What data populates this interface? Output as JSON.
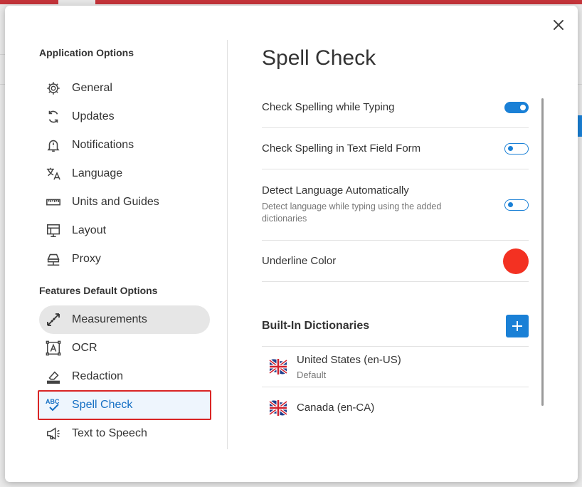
{
  "dialog": {
    "sidebar": {
      "application_section": "Application Options",
      "application_items": [
        {
          "label": "General",
          "icon": "gear-icon"
        },
        {
          "label": "Updates",
          "icon": "sync-icon"
        },
        {
          "label": "Notifications",
          "icon": "bell-icon"
        },
        {
          "label": "Language",
          "icon": "translate-icon"
        },
        {
          "label": "Units and Guides",
          "icon": "ruler-icon"
        },
        {
          "label": "Layout",
          "icon": "layout-icon"
        },
        {
          "label": "Proxy",
          "icon": "network-icon"
        }
      ],
      "features_section": "Features Default Options",
      "feature_items": [
        {
          "label": "Measurements",
          "icon": "measure-icon"
        },
        {
          "label": "OCR",
          "icon": "ocr-icon"
        },
        {
          "label": "Redaction",
          "icon": "eraser-icon"
        },
        {
          "label": "Spell Check",
          "icon": "spellcheck-icon"
        },
        {
          "label": "Text to Speech",
          "icon": "megaphone-icon"
        }
      ]
    },
    "content": {
      "title": "Spell Check",
      "settings": [
        {
          "label": "Check Spelling while Typing",
          "enabled": true
        },
        {
          "label": "Check Spelling in Text Field Form",
          "enabled": false
        },
        {
          "label": "Detect Language Automatically",
          "description": "Detect language while typing using the added dictionaries",
          "enabled": false
        }
      ],
      "underline_color": {
        "label": "Underline Color",
        "value": "#f33122"
      },
      "dictionaries": {
        "title": "Built-In Dictionaries",
        "items": [
          {
            "name": "United States (en-US)",
            "sub": "Default"
          },
          {
            "name": "Canada (en-CA)",
            "sub": ""
          }
        ]
      }
    }
  },
  "colors": {
    "accent": "#1a80d6",
    "active_outline": "#d92525"
  }
}
